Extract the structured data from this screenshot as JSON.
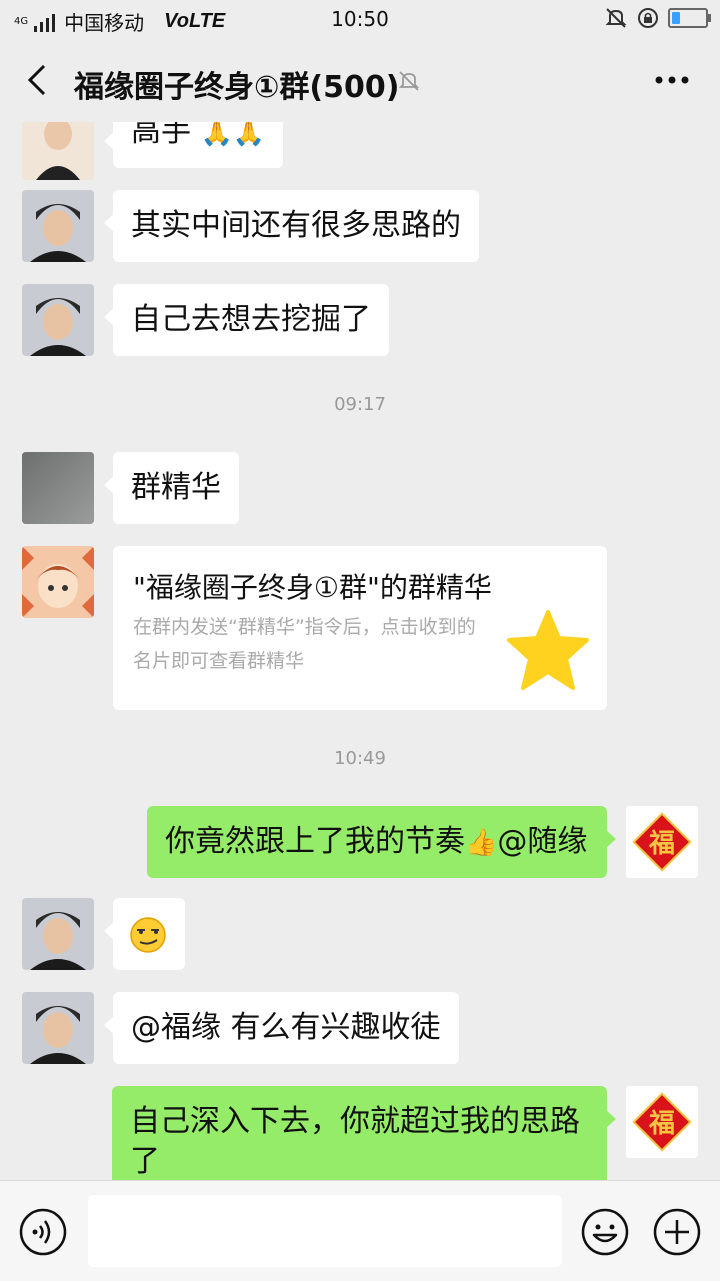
{
  "status_bar": {
    "network": "4G",
    "carrier": "中国移动",
    "volte": "VoLTE",
    "time": "10:50"
  },
  "header": {
    "title": "福缘圈子终身①群(500)"
  },
  "messages": {
    "m0": "高手",
    "m1": "其实中间还有很多思路的",
    "m2": "自己去想去挖掘了",
    "t1": "09:17",
    "m3": "群精华",
    "card_title": "\"福缘圈子终身①群\"的群精华",
    "card_desc": "在群内发送“群精华”指令后，点击收到的名片即可查看群精华",
    "t2": "10:49",
    "m4a": "你竟然跟上了我的节奏",
    "m4b": "@随缘",
    "m6": "@福缘  有么有兴趣收徒",
    "m7": "自己深入下去，你就超过我的思路了"
  },
  "avatar_text": "福",
  "colors": {
    "sent_bubble": "#95ec69",
    "received_bubble": "#ffffff",
    "background": "#ededed"
  }
}
